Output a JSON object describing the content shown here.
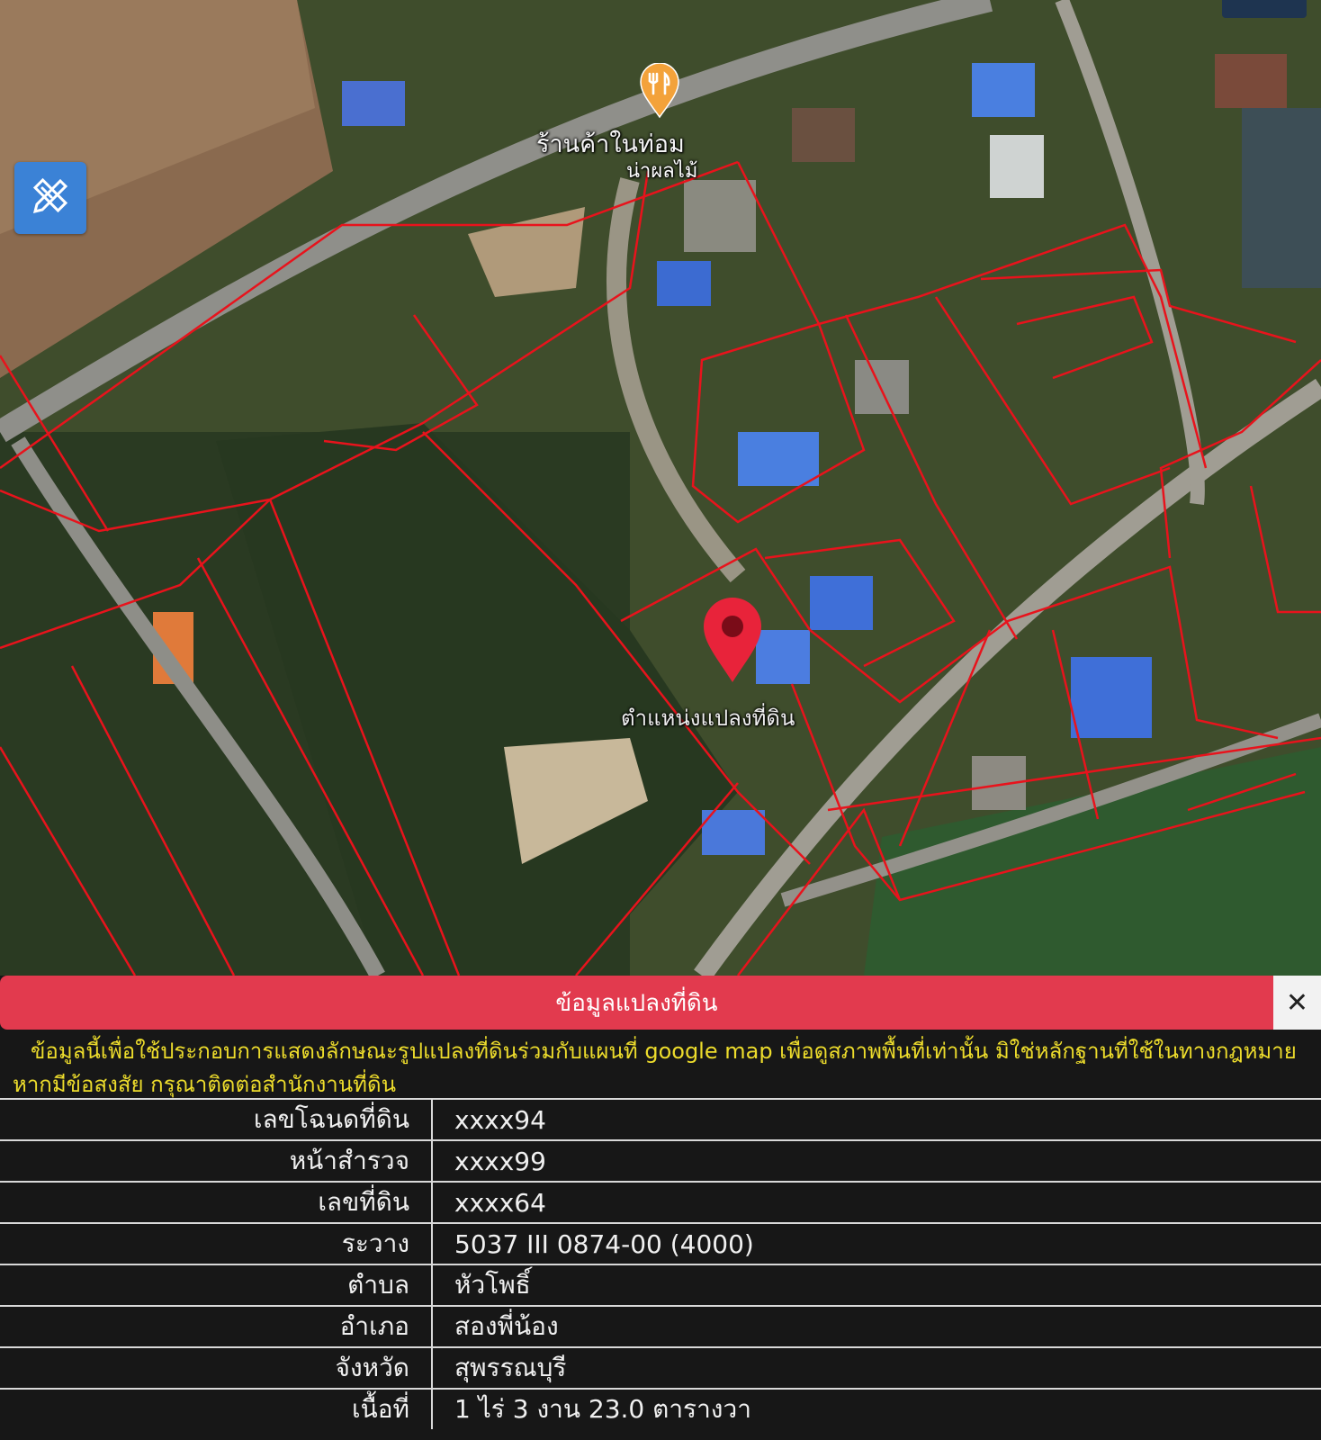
{
  "map": {
    "poi_label_line1": "ร้านค้าในท่อม",
    "poi_label_line2": "น่าผลไม้",
    "pin_label": "ตำแหน่งแปลงที่ดิน",
    "poi_icon": "restaurant-icon",
    "pin_icon": "location-pin-icon",
    "tool_icon": "ruler-pencil-icon",
    "accent_colors": {
      "parcel_lines": "#e8131c",
      "pin": "#e8233a",
      "tool_button": "#3b82d6"
    }
  },
  "panel": {
    "title": "ข้อมูลแปลงที่ดิน",
    "close_label": "✕",
    "notice_line1": "ข้อมูลนี้เพื่อใช้ประกอบการแสดงลักษณะรูปแปลงที่ดินร่วมกับแผนที่ google map เพื่อดูสภาพพื้นที่เท่านั้น มิใช่หลักฐานที่ใช้ในทางกฎหมาย",
    "notice_line2": "หากมีข้อสงสัย กรุณาติดต่อสำนักงานที่ดิน",
    "header_color": "#e23a4e",
    "notice_color": "#eddc2c",
    "rows": [
      {
        "label": "เลขโฉนดที่ดิน",
        "value": "xxxx94"
      },
      {
        "label": "หน้าสำรวจ",
        "value": "xxxx99"
      },
      {
        "label": "เลขที่ดิน",
        "value": "xxxx64"
      },
      {
        "label": "ระวาง",
        "value": "5037 III 0874-00 (4000)"
      },
      {
        "label": "ตำบล",
        "value": "หัวโพธิ์"
      },
      {
        "label": "อำเภอ",
        "value": "สองพี่น้อง"
      },
      {
        "label": "จังหวัด",
        "value": "สุพรรณบุรี"
      },
      {
        "label": "เนื้อที่",
        "value": "1 ไร่ 3 งาน 23.0 ตารางวา"
      }
    ]
  }
}
